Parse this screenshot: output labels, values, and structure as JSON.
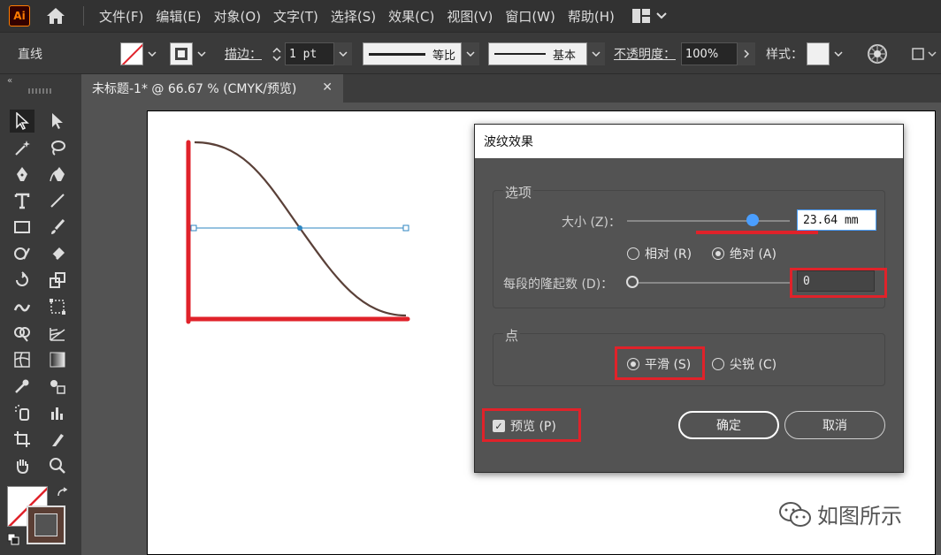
{
  "app": {
    "logo": "Ai"
  },
  "menu": [
    "文件(F)",
    "编辑(E)",
    "对象(O)",
    "文字(T)",
    "选择(S)",
    "效果(C)",
    "视图(V)",
    "窗口(W)",
    "帮助(H)"
  ],
  "control_bar": {
    "object_type": "直线",
    "stroke_label": "描边：",
    "stroke_weight": "1 pt",
    "profile_label": "等比",
    "brush_label": "基本",
    "opacity_label": "不透明度：",
    "opacity_value": "100%",
    "style_label": "样式："
  },
  "tab": {
    "title": "未标题-1* @ 66.67 % (CMYK/预览)",
    "close": "✕"
  },
  "dialog": {
    "title": "波纹效果",
    "options_group": "选项",
    "size_label": "大小 (Z)：",
    "size_value": "23.64 mm",
    "size_slider": 0.77,
    "relative_label": "相对 (R)",
    "absolute_label": "绝对 (A)",
    "ridges_label": "每段的隆起数 (D)：",
    "ridges_value": "0",
    "ridges_slider": 0,
    "points_group": "点",
    "smooth_label": "平滑 (S)",
    "corner_label": "尖锐 (C)",
    "preview_label": "预览 (P)",
    "ok_label": "确定",
    "cancel_label": "取消"
  },
  "watermark": "如图所示",
  "colors": {
    "highlight": "#e0222a",
    "accent": "#4a9eff",
    "path": "#5a4038",
    "guide": "#2e86c1"
  }
}
